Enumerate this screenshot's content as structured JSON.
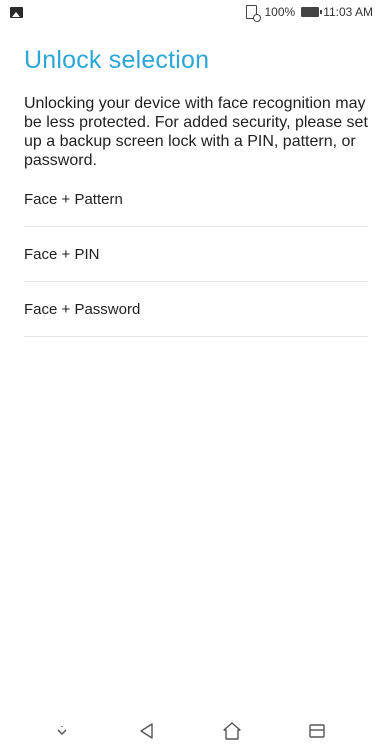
{
  "status_bar": {
    "battery": "100%",
    "time": "11:03 AM",
    "icons": [
      "image-icon",
      "sim-icon",
      "battery-icon"
    ]
  },
  "page": {
    "title": "Unlock selection",
    "description": "Unlocking your device with face recognition may be less protected. For added security, please set up a backup screen lock with a PIN, pattern, or password."
  },
  "options": [
    {
      "label": "Face + Pattern"
    },
    {
      "label": "Face + PIN"
    },
    {
      "label": "Face + Password"
    }
  ],
  "nav_bar": {
    "icons": [
      "chevron-down-icon",
      "back-icon",
      "home-icon",
      "recents-icon"
    ]
  },
  "colors": {
    "accent": "#2aa7d6",
    "text": "#1f1f1f",
    "divider": "#e4e4e4"
  }
}
